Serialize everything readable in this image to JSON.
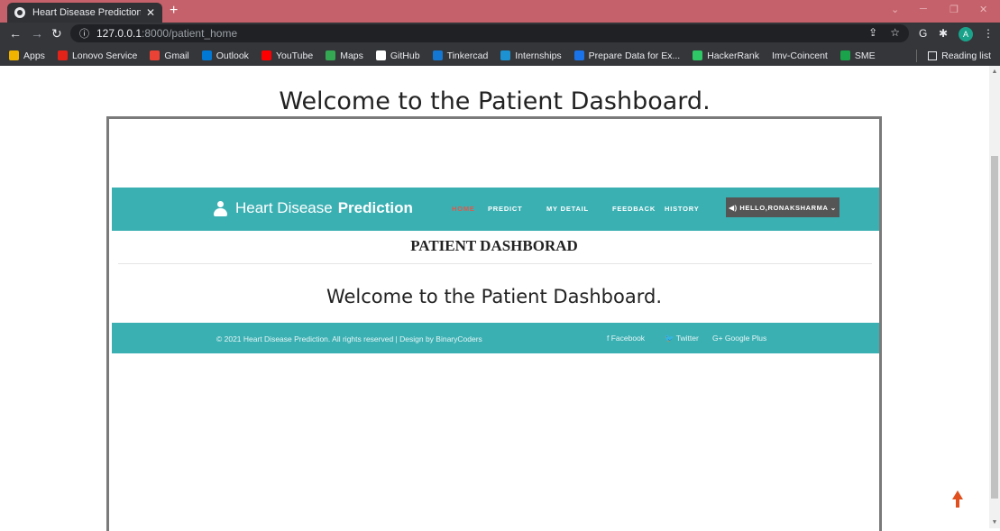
{
  "browser": {
    "tab_title": "Heart Disease Prediction System",
    "tab_close": "✕",
    "new_tab": "+",
    "url_host": "127.0.0.1",
    "url_rest": ":8000/patient_home",
    "bookmarks": [
      {
        "label": "Apps",
        "color": "#f0b400"
      },
      {
        "label": "Lonovo Service",
        "color": "#e2231a"
      },
      {
        "label": "Gmail",
        "color": "#ea4335"
      },
      {
        "label": "Outlook",
        "color": "#0078d4"
      },
      {
        "label": "YouTube",
        "color": "#ff0000"
      },
      {
        "label": "Maps",
        "color": "#34a853"
      },
      {
        "label": "GitHub",
        "color": "#ffffff"
      },
      {
        "label": "Tinkercad",
        "color": "#1477d1"
      },
      {
        "label": "Internships",
        "color": "#1c92d2"
      },
      {
        "label": "Prepare Data for Ex...",
        "color": "#1a73e8"
      },
      {
        "label": "HackerRank",
        "color": "#2ec866"
      },
      {
        "label": "Imv-Coincent",
        "color": ""
      },
      {
        "label": "SME",
        "color": "#1aa34a"
      }
    ],
    "reading_list": "Reading list",
    "avatar_letter": "A"
  },
  "page": {
    "heading": "Welcome to the Patient Dashboard.",
    "site": {
      "brand_light": "Heart Disease",
      "brand_bold": "Prediction",
      "menu": [
        "HOME",
        "PREDICT",
        "MY DETAIL",
        "FEEDBACK",
        "HISTORY"
      ],
      "hello": "◀) HELLO,RONAKSHARMA ⌄",
      "dashboard_title": "PATIENT DASHBORAD",
      "welcome": "Welcome to the Patient Dashboard.",
      "footer_copyright": "© 2021 Heart Disease Prediction. All rights reserved | Design by BinaryCoders",
      "social": [
        "f  Facebook",
        "🐦 Twitter",
        "G+ Google Plus"
      ]
    }
  },
  "colors": {
    "teal": "#3bb0b3",
    "tab_strip": "#c5616a",
    "active_menu": "#e0584a",
    "to_top_arrow": "#e0501e"
  }
}
